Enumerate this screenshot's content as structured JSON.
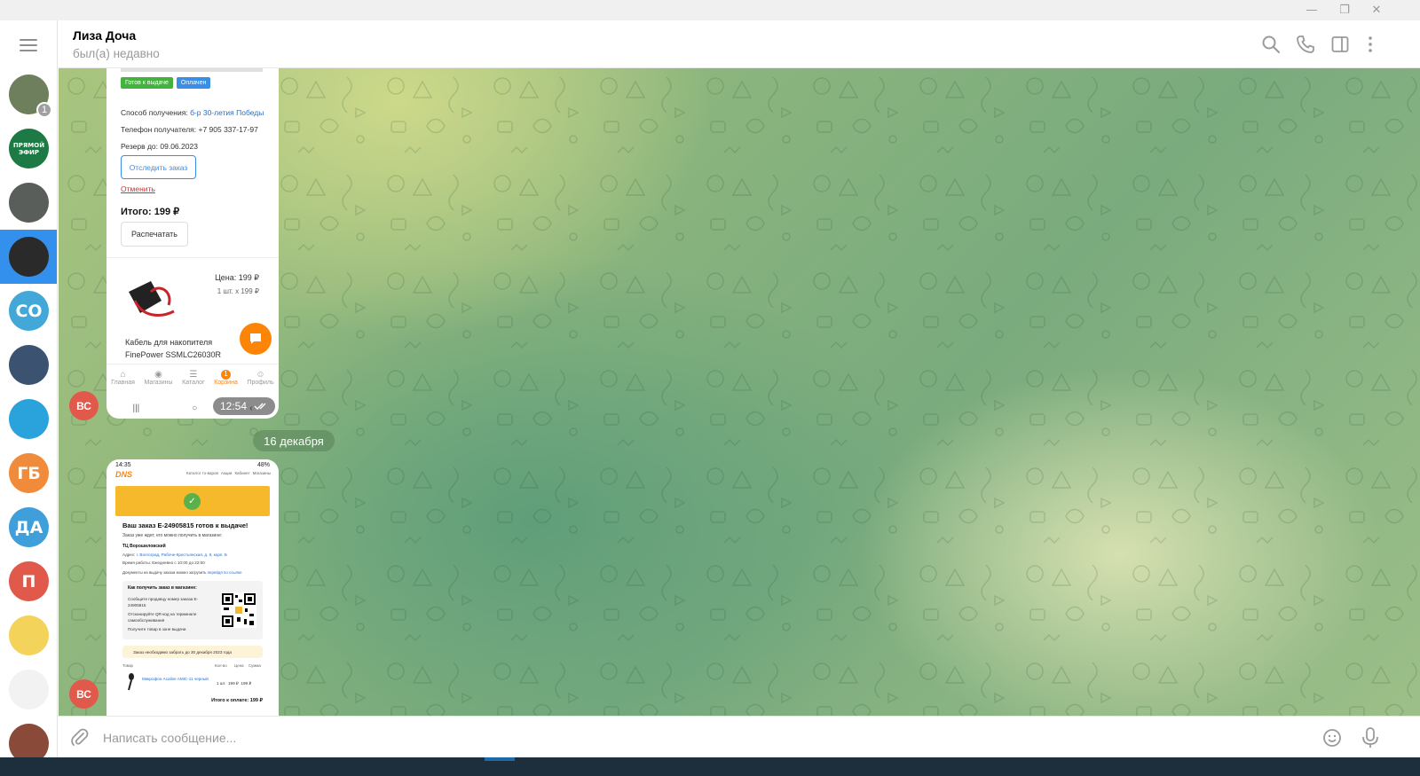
{
  "window": {
    "minimize": "—",
    "restore": "❐",
    "close": "✕"
  },
  "header": {
    "title": "Лиза Доча",
    "status": "был(а) недавно"
  },
  "sidebar": {
    "chats": [
      {
        "initials": "",
        "color": "#6d7f5c",
        "unread": "1"
      },
      {
        "initials": "",
        "color": "#1e7a44",
        "badge_text": "ПРЯМОЙ ЭФИР"
      },
      {
        "initials": "",
        "color": "#5a5e5a"
      },
      {
        "initials": "",
        "color": "#2a2a2a",
        "active": true
      },
      {
        "initials": "СО",
        "color": "#43a8d8"
      },
      {
        "initials": "",
        "color": "#3b5270"
      },
      {
        "initials": "",
        "color": "#2aa3dd"
      },
      {
        "initials": "ГБ",
        "color": "#f08b3b"
      },
      {
        "initials": "ДА",
        "color": "#3f9fdb"
      },
      {
        "initials": "П",
        "color": "#e0594a"
      },
      {
        "initials": "",
        "color": "#f4d35a"
      },
      {
        "initials": "",
        "color": "#f2f2f2"
      },
      {
        "initials": "",
        "color": "#8a4a3a"
      }
    ]
  },
  "messages": {
    "sender_initials": "ВС",
    "date_separator": "16 декабря",
    "first": {
      "time": "12:54",
      "status_badges": [
        "Готов к выдаче",
        "Оплачен"
      ],
      "pickup_label": "Способ получения:",
      "pickup_value": "б-р 30-летия Победы",
      "phone_label": "Телефон получателя: +7 905 337-17-97",
      "reserve": "Резерв до: 09.06.2023",
      "track_button": "Отследить заказ",
      "cancel_link": "Отменить",
      "total": "Итого: 199 ₽",
      "print_button": "Распечатать",
      "price_label": "Цена: 199 ₽",
      "qty_label": "1 шт. x 199 ₽",
      "product_name": "Кабель для накопителя FinePower SSMLC26030R",
      "nav": [
        "Главная",
        "Магазины",
        "Каталог",
        "Корзина",
        "Профиль"
      ],
      "cart_count": "1"
    },
    "second": {
      "status_time": "14:35",
      "battery": "48%",
      "brand": "DNS",
      "menu_items": [
        "Каталог то-варов",
        "Акции",
        "Кабинет",
        "Магазины"
      ],
      "heading": "Ваш заказ E-24905815 готов к выдаче!",
      "sub": "Заказ уже ждет, его можно получить в магазине:",
      "store": "ТЦ Ворошиловский",
      "address_label": "Адрес:",
      "address_value": "г. Волгоград, Рабоче-Крестьянская, д. 9, корп. Б",
      "hours": "Время работы: Ежедневно с 10:00 до 22:00",
      "docs": "Документы на выдачу заказа можно загрузить",
      "docs_link": "перейдя по ссылке",
      "howto_title": "Как получить заказ в магазине:",
      "steps": [
        "Сообщите продавцу номер заказа E-24905815",
        "Отсканируйте QR-код на терминале самообслуживания",
        "Получите товар в зоне выдачи"
      ],
      "deadline": "Заказ необходимо забрать до 30 декабря 2023 года",
      "table_headers": [
        "Товар",
        "Кол-во",
        "Цена",
        "Сумма"
      ],
      "item_name": "Микрофон Acaline AMIC-11 черный",
      "item_qty": "1 шт.",
      "item_price": "199 ₽",
      "item_sum": "199 ₽",
      "grand_total": "Итого к оплате: 199 ₽"
    }
  },
  "composer": {
    "placeholder": "Написать сообщение..."
  },
  "colors": {
    "accent": "#3390ec",
    "orange": "#fc8507",
    "avatar_red": "#e0594a"
  }
}
